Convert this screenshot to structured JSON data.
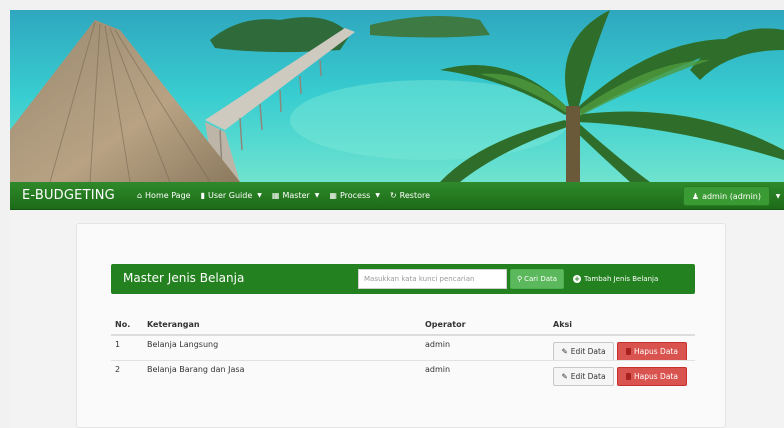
{
  "navbar": {
    "brand": "E-BUDGETING",
    "items": [
      {
        "icon": "home-icon",
        "label": "Home Page",
        "dropdown": false
      },
      {
        "icon": "comment-icon",
        "label": "User Guide",
        "dropdown": true
      },
      {
        "icon": "grid-icon",
        "label": "Master",
        "dropdown": true
      },
      {
        "icon": "grid-icon",
        "label": "Process",
        "dropdown": true
      },
      {
        "icon": "refresh-icon",
        "label": "Restore",
        "dropdown": false
      }
    ],
    "user_label": "admin (admin)"
  },
  "panel": {
    "title": "Master Jenis Belanja",
    "search_placeholder": "Masukkan kata kunci pencarian",
    "search_button": "Cari Data",
    "add_button": "Tambah Jenis Belanja"
  },
  "table": {
    "headers": {
      "no": "No.",
      "keterangan": "Keterangan",
      "operator": "Operator",
      "aksi": "Aksi"
    },
    "rows": [
      {
        "no": "1",
        "keterangan": "Belanja Langsung",
        "operator": "admin"
      },
      {
        "no": "2",
        "keterangan": "Belanja Barang dan Jasa",
        "operator": "admin"
      }
    ],
    "edit_label": "Edit Data",
    "delete_label": "Hapus Data"
  },
  "colors": {
    "navbar": "#1d6b18",
    "panel_header": "#23811f",
    "search_button": "#5cb85c",
    "delete_button": "#d9534f"
  }
}
